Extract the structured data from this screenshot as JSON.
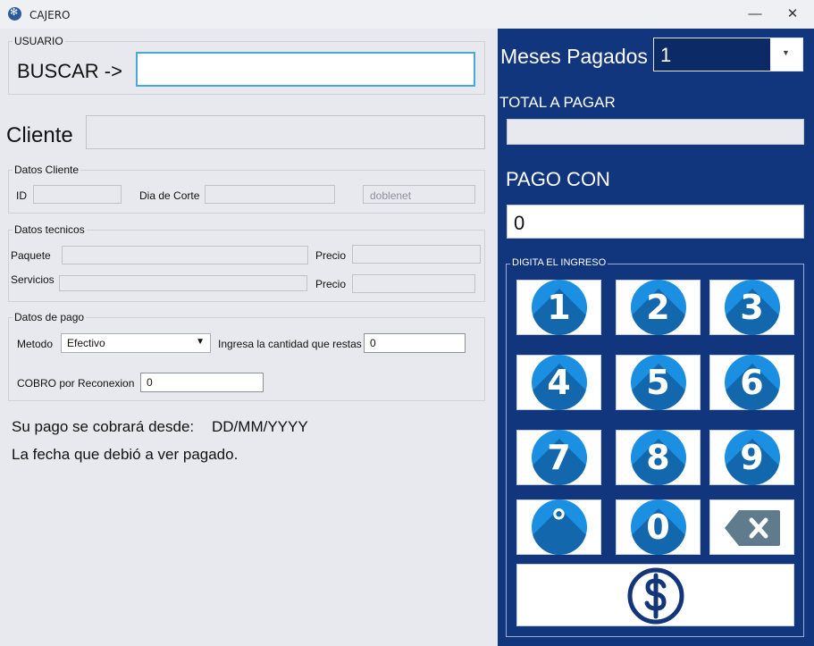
{
  "window": {
    "title": "CAJERO"
  },
  "usuario": {
    "legend": "USUARIO",
    "buscar_label": "BUSCAR ->",
    "buscar_value": ""
  },
  "cliente": {
    "label": "Cliente",
    "value": ""
  },
  "datos_cliente": {
    "legend": "Datos Cliente",
    "id_label": "ID",
    "dia_corte_label": "Dia de Corte",
    "empresa_value": "doblenet"
  },
  "datos_tecnicos": {
    "legend": "Datos tecnicos",
    "paquete_label": "Paquete",
    "precio1_label": "Precio",
    "servicios_label": "Servicios",
    "precio2_label": "Precio"
  },
  "datos_pago": {
    "legend": "Datos de pago",
    "metodo_label": "Metodo",
    "metodo_value": "Efectivo",
    "cantidad_label": "Ingresa la cantidad que restas",
    "cantidad_value": "0",
    "cobro_label": "COBRO por Reconexion",
    "cobro_value": "0"
  },
  "info": {
    "desde_label": "Su pago se cobrará desde:",
    "desde_value": "DD/MM/YYYY",
    "fecha_text": "La fecha que debió a ver pagado."
  },
  "panel": {
    "meses_label": "Meses Pagados",
    "meses_value": "1",
    "total_label": "TOTAL A PAGAR",
    "total_value": "",
    "pago_label": "PAGO CON",
    "pago_value": "0",
    "keypad_legend": "DIGITA EL INGRESO"
  },
  "keypad": {
    "keys": [
      "1",
      "2",
      "3",
      "4",
      "5",
      "6",
      "7",
      "8",
      "9",
      "°",
      "0"
    ],
    "backspace_icon": "backspace-icon",
    "pay_icon": "dollar-icon"
  },
  "colors": {
    "panel": "#12367e",
    "key_circle": "#1b8fe2",
    "accent_border": "#4aa8d8"
  }
}
